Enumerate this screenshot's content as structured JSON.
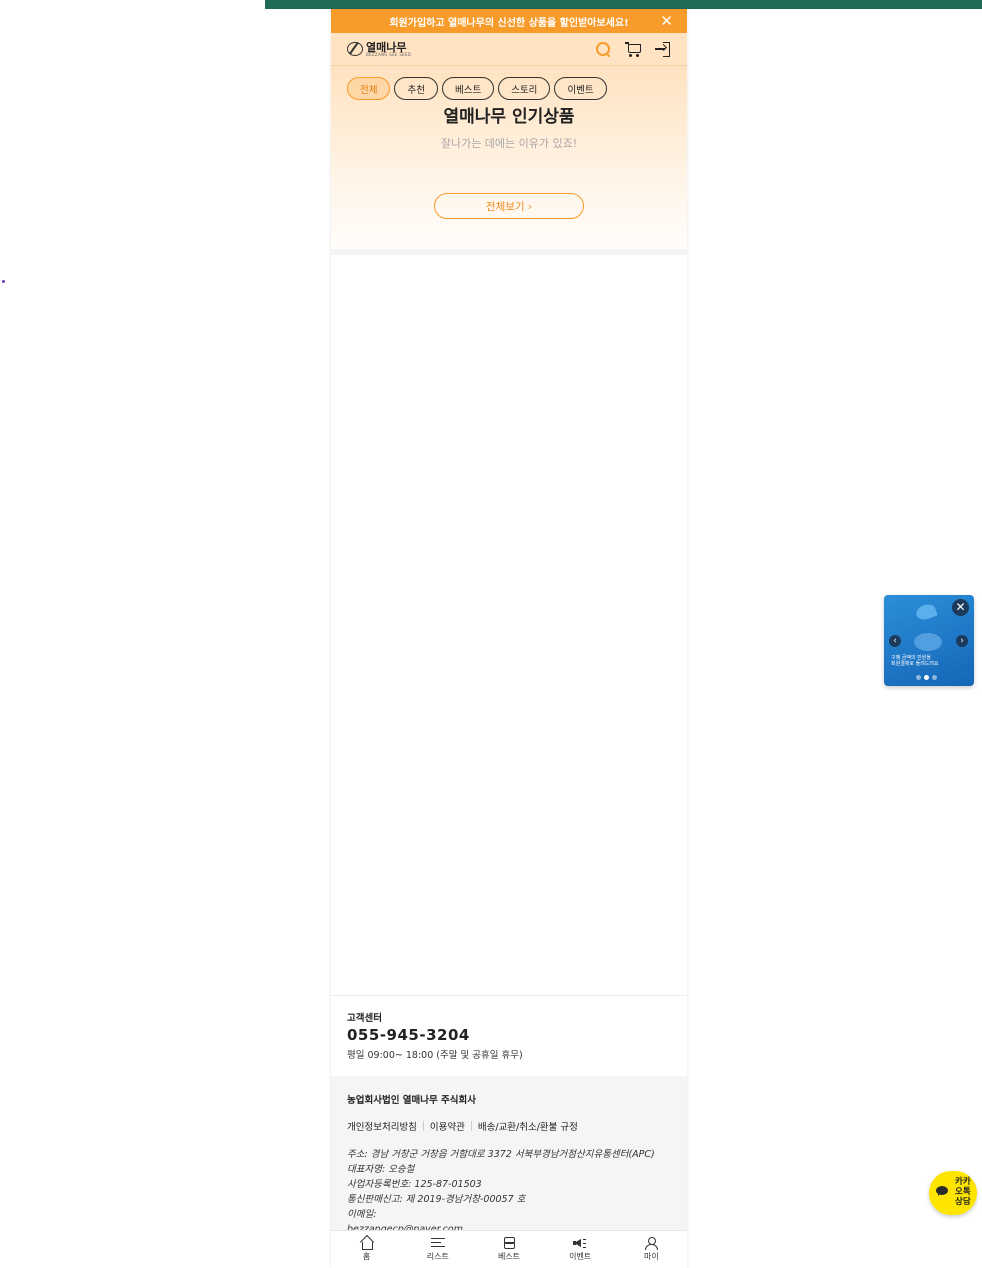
{
  "promo": {
    "text": "회원가입하고 열매나무의 신선한 상품을 할인받아보세요!",
    "close": "✕"
  },
  "header": {
    "logo_text": "열매나무",
    "logo_sub": "BEZZANG SEE SEED"
  },
  "tabs": [
    {
      "label": "전체",
      "active": true
    },
    {
      "label": "추천",
      "active": false
    },
    {
      "label": "베스트",
      "active": false
    },
    {
      "label": "스토리",
      "active": false
    },
    {
      "label": "이벤트",
      "active": false
    }
  ],
  "hero": {
    "title": "열매나무 인기상품",
    "subtitle": "잘나가는 데에는 이유가 있죠!",
    "button": "전체보기 ›"
  },
  "customer_center": {
    "title": "고객센터",
    "phone": "055-945-3204",
    "hours": "평일 09:00~ 18:00 (주말 및 공휴일 휴무)"
  },
  "company": {
    "name": "농업회사법인 열매나무 주식회사",
    "links": [
      "개인정보처리방침",
      "이용약관",
      "배송/교환/취소/환불 규정"
    ],
    "address": "주소: 경남 거창군 거창읍 거함대로 3372 서북부경남거점산지유통센터(APC)",
    "ceo": "대표자명: 오승철",
    "biz_no": "사업자등록번호: 125-87-01503",
    "mail_order": "통신판매신고: 제 2019-경남거창-00057 호",
    "email_label": "이메일:",
    "email": "bezzangecp@naver.com"
  },
  "bottom_nav": [
    {
      "label": "홈",
      "icon": "home-icon"
    },
    {
      "label": "리스트",
      "icon": "list-icon"
    },
    {
      "label": "베스트",
      "icon": "best-icon"
    },
    {
      "label": "이벤트",
      "icon": "event-icon"
    },
    {
      "label": "마이",
      "icon": "my-icon"
    }
  ],
  "float_banner": {
    "text_line1": "구매 금액의 만원을",
    "text_line2": "회원결제로 돌려드려요",
    "active_dot": 1
  },
  "kakao": {
    "label": "카카오톡상담"
  },
  "colors": {
    "accent": "#f79b2a",
    "topbar": "#1e6b58",
    "kakao": "#fee500"
  }
}
